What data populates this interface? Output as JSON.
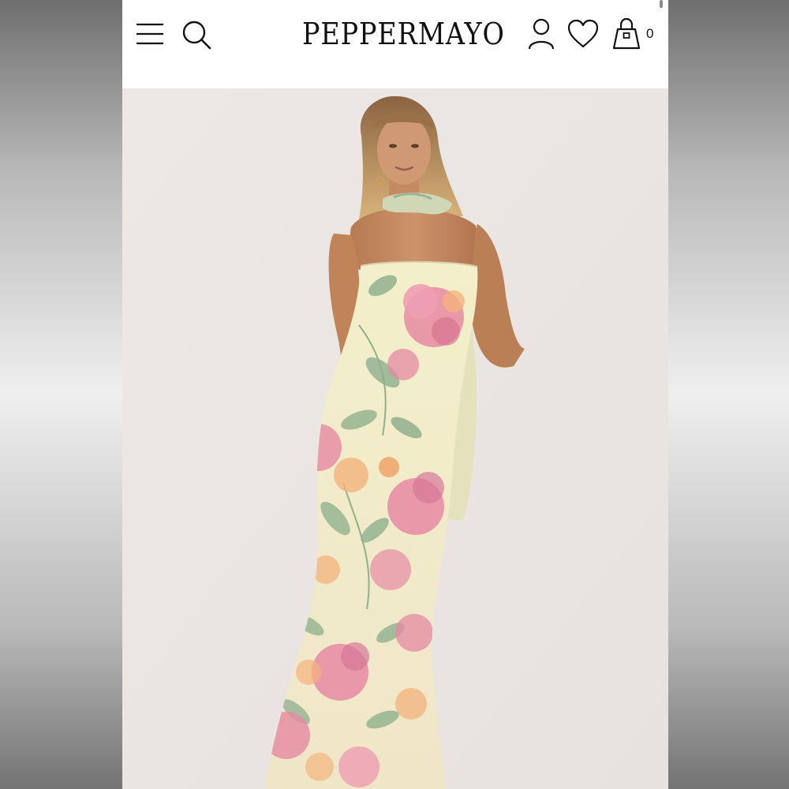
{
  "brand": {
    "name": "PEPPERMAYO"
  },
  "header": {
    "menu_icon": "hamburger-menu-icon",
    "search_icon": "search-icon",
    "account_icon": "user-icon",
    "wishlist_icon": "heart-icon",
    "cart_icon": "shopping-bag-icon",
    "cart_count": "0"
  },
  "product": {
    "image": "model-wearing-strapless-floral-maxi-dress-with-scarf",
    "dress_colors": [
      "#f1edc6",
      "#e68aa2",
      "#8fb08d",
      "#f3b37c"
    ]
  },
  "colors": {
    "header_bg": "#ffffff",
    "photo_bg": "#ebe7e4",
    "ink": "#111111"
  }
}
